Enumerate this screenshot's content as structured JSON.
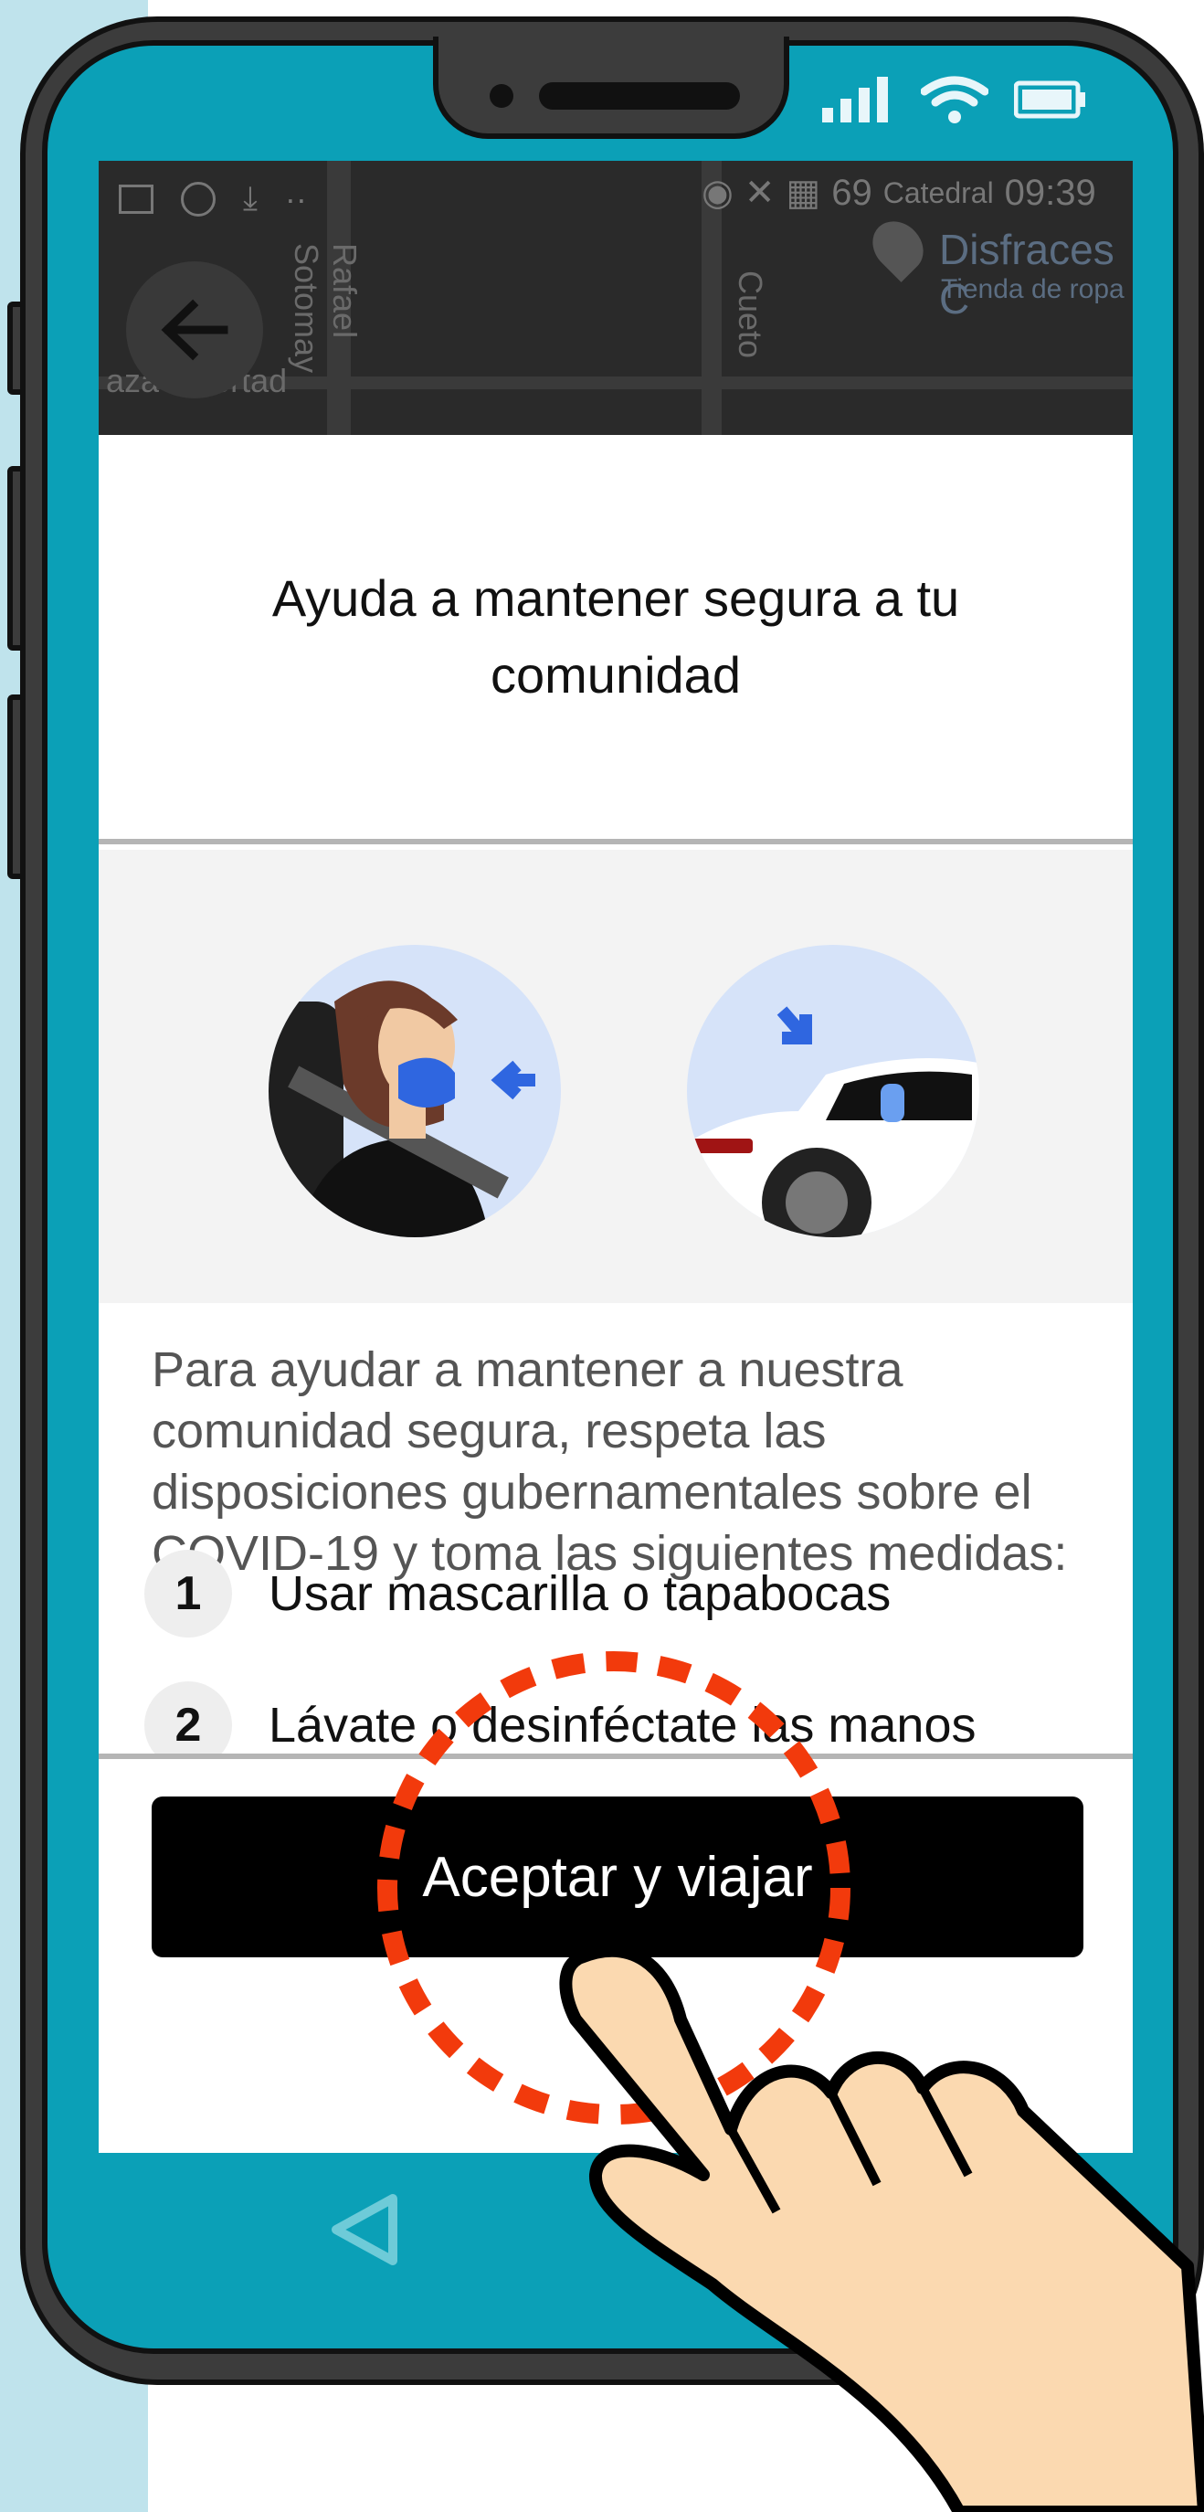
{
  "status_bar": {
    "carrier": "Catedral",
    "time": "09:39",
    "battery": "69"
  },
  "map": {
    "streets": [
      "Rafael Sotomay",
      "Cueto",
      "aza Libertad"
    ],
    "place_name": "Disfraces C",
    "place_category": "Tienda de ropa"
  },
  "dialog": {
    "title": "Ayuda a mantener segura a tu comunidad",
    "body": "Para ayudar a mantener a nuestra comunidad segura, respeta las disposiciones gubernamentales sobre el COVID-19 y toma las siguientes medidas:",
    "steps": [
      {
        "number": "1",
        "label": "Usar mascarilla o tapabocas"
      },
      {
        "number": "2",
        "label": "Lávate o desinféctate las manos"
      }
    ],
    "accept_label": "Aceptar y viajar"
  },
  "icons": {
    "back": "arrow-left-icon",
    "nav_back": "triangle-back-icon",
    "signal": "signal-icon",
    "wifi": "wifi-icon",
    "battery": "battery-icon"
  },
  "colors": {
    "phone_screen_frame": "#0ba0b7",
    "sidebar_strip": "#bfe3ec",
    "tap_circle": "#f23a0c",
    "hand_skin": "#fbd9b0",
    "mask": "#2f66e0"
  }
}
